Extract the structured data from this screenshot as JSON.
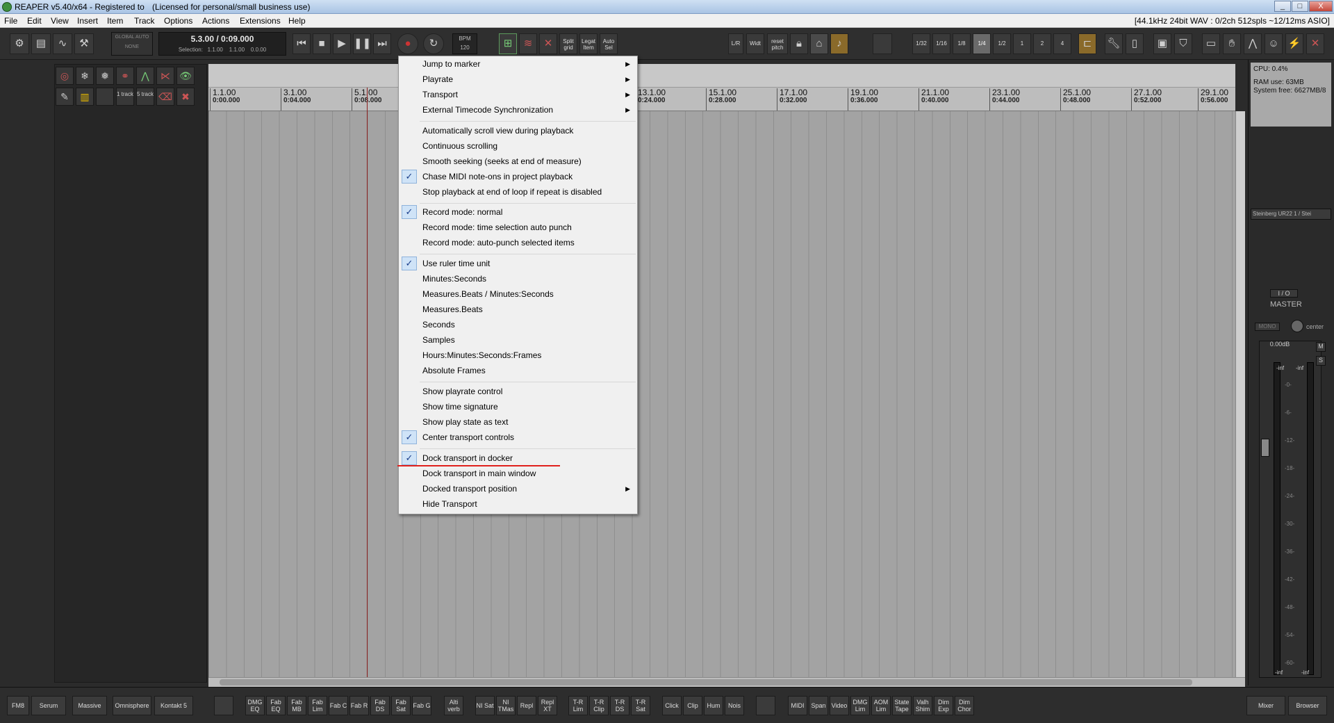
{
  "window": {
    "title": "REAPER v5.40/x64 - Registered to",
    "license": "(Licensed for personal/small business use)",
    "minimize": "_",
    "maximize": "□",
    "close": "X"
  },
  "menubar": {
    "items": [
      "File",
      "Edit",
      "View",
      "Insert",
      "Item",
      "Track",
      "Options",
      "Actions",
      "Extensions",
      "Help"
    ],
    "status": "[44.1kHz 24bit WAV : 0/2ch 512spls ~12/12ms ASIO]"
  },
  "toolbar": {
    "global_auto": "GLOBAL AUTO",
    "global_none": "NONE",
    "position": "5.3.00 / 0:09.000",
    "selection_label": "Selection:",
    "sel_start": "1.1.00",
    "sel_end": "1.1.00",
    "sel_len": "0.0.00",
    "bpm_label": "BPM",
    "bpm_value": "120",
    "split_grid": "Split grid",
    "legat_item": "Legat Item",
    "auto_sel": "Auto Sel",
    "lr": "L/R",
    "widt": "Widt",
    "reset_pitch": "reset pitch",
    "grid": [
      "1/32",
      "1/16",
      "1/8",
      "1/4",
      "1/2",
      "1",
      "2",
      "4"
    ]
  },
  "tcp": {
    "track1": "1 track",
    "track5": "5 track"
  },
  "ruler": {
    "marks": [
      {
        "bar": "1.1.00",
        "time": "0:00.000"
      },
      {
        "bar": "3.1.00",
        "time": "0:04.000"
      },
      {
        "bar": "5.1.00",
        "time": "0:08.000"
      },
      {
        "bar": "13.1.00",
        "time": "0:24.000"
      },
      {
        "bar": "15.1.00",
        "time": "0:28.000"
      },
      {
        "bar": "17.1.00",
        "time": "0:32.000"
      },
      {
        "bar": "19.1.00",
        "time": "0:36.000"
      },
      {
        "bar": "21.1.00",
        "time": "0:40.000"
      },
      {
        "bar": "23.1.00",
        "time": "0:44.000"
      },
      {
        "bar": "25.1.00",
        "time": "0:48.000"
      },
      {
        "bar": "27.1.00",
        "time": "0:52.000"
      },
      {
        "bar": "29.1.00",
        "time": "0:56.000"
      }
    ]
  },
  "perf": {
    "cpu": "CPU: 0.4%",
    "ram": "RAM use: 63MB",
    "sysfree": "System free: 6627MB/8"
  },
  "mixer": {
    "device": "Steinberg UR22 1 / Stei",
    "io": "I / O",
    "master": "MASTER",
    "mono": "MONO",
    "center": "center",
    "db": "0.00dB",
    "inf_l": "-inf",
    "inf_r": "-inf",
    "m": "M",
    "s": "S",
    "scale": [
      "-0-",
      "-6-",
      "-12-",
      "-18-",
      "-24-",
      "-30-",
      "-36-",
      "-42-",
      "-48-",
      "-54-",
      "-60-"
    ],
    "bottom_l": "-inf",
    "bottom_r": "-inf"
  },
  "context_menu": {
    "items": [
      {
        "label": "Jump to marker",
        "sub": true
      },
      {
        "label": "Playrate",
        "sub": true
      },
      {
        "label": "Transport",
        "sub": true
      },
      {
        "label": "External Timecode Synchronization",
        "sub": true
      },
      {
        "sep": true
      },
      {
        "label": "Automatically scroll view during playback"
      },
      {
        "label": "Continuous scrolling"
      },
      {
        "label": "Smooth seeking (seeks at end of measure)"
      },
      {
        "label": "Chase MIDI note-ons in project playback",
        "checked": true
      },
      {
        "label": "Stop playback at end of loop if repeat is disabled"
      },
      {
        "sep": true
      },
      {
        "label": "Record mode: normal",
        "checked": true
      },
      {
        "label": "Record mode: time selection auto punch"
      },
      {
        "label": "Record mode: auto-punch selected items"
      },
      {
        "sep": true
      },
      {
        "label": "Use ruler time unit",
        "checked": true
      },
      {
        "label": "Minutes:Seconds"
      },
      {
        "label": "Measures.Beats / Minutes:Seconds"
      },
      {
        "label": "Measures.Beats"
      },
      {
        "label": "Seconds"
      },
      {
        "label": "Samples"
      },
      {
        "label": "Hours:Minutes:Seconds:Frames"
      },
      {
        "label": "Absolute Frames"
      },
      {
        "sep": true
      },
      {
        "label": "Show playrate control"
      },
      {
        "label": "Show time signature"
      },
      {
        "label": "Show play state as text"
      },
      {
        "label": "Center transport controls",
        "checked": true
      },
      {
        "sep": true
      },
      {
        "label": "Dock transport in docker",
        "checked": true
      },
      {
        "label": "Dock transport in main window"
      },
      {
        "label": "Docked transport position",
        "sub": true
      },
      {
        "label": "Hide Transport"
      }
    ]
  },
  "bottom": {
    "buttons": [
      "FM8",
      "Serum",
      "Massive",
      "Omnisphere",
      "Kontakt 5",
      "",
      "DMG EQ",
      "Fab EQ",
      "Fab MB",
      "Fab Lim",
      "Fab C",
      "Fab R",
      "Fab DS",
      "Fab Sat",
      "Fab G",
      "Alti verb",
      "NI Sat",
      "NI TMas",
      "Repl",
      "Repl XT",
      "T-R Lim",
      "T-R Clip",
      "T-R DS",
      "T-R Sat",
      "Click",
      "Clip",
      "Hum",
      "Nois",
      "",
      "MIDI",
      "Span",
      "Video",
      "DMG Lim",
      "AOM Lim",
      "State Tape",
      "Valh Shim",
      "Dim Exp",
      "Dim Chor",
      "Mixer",
      "Browser"
    ]
  },
  "colors": {
    "accent_red": "#e0201c",
    "arrange_bg": "#a3a3a3",
    "menu_bg": "#f0f0f0",
    "check_bg": "#cfe3f7"
  }
}
